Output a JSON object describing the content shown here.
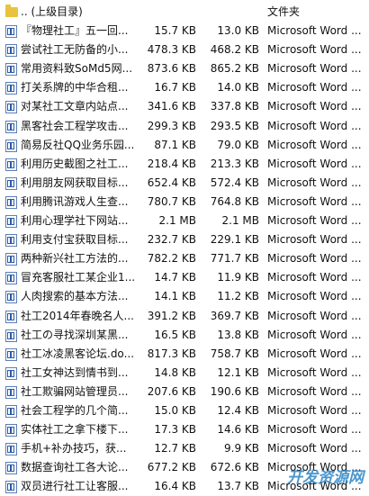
{
  "header": {
    "parent_label": ".. (上级目录)",
    "type_header": "文件夹"
  },
  "files": [
    {
      "name": "『物理社工』五一回...",
      "size": "15.7 KB",
      "packed": "13.0 KB",
      "type": "Microsoft Word ..."
    },
    {
      "name": "尝试社工无防备的小...",
      "size": "478.3 KB",
      "packed": "468.2 KB",
      "type": "Microsoft Word ..."
    },
    {
      "name": "常用资料致SoMd5网...",
      "size": "873.6 KB",
      "packed": "865.2 KB",
      "type": "Microsoft Word ..."
    },
    {
      "name": "打关系牌的中华合租...",
      "size": "16.7 KB",
      "packed": "14.0 KB",
      "type": "Microsoft Word ..."
    },
    {
      "name": "对某社工文章内站点...",
      "size": "341.6 KB",
      "packed": "337.8 KB",
      "type": "Microsoft Word ..."
    },
    {
      "name": "黑客社会工程学攻击...",
      "size": "299.3 KB",
      "packed": "293.5 KB",
      "type": "Microsoft Word ..."
    },
    {
      "name": "简易反社QQ业务乐园...",
      "size": "87.1 KB",
      "packed": "79.0 KB",
      "type": "Microsoft Word ..."
    },
    {
      "name": "利用历史截图之社工...",
      "size": "218.4 KB",
      "packed": "213.3 KB",
      "type": "Microsoft Word ..."
    },
    {
      "name": "利用朋友网获取目标...",
      "size": "652.4 KB",
      "packed": "572.4 KB",
      "type": "Microsoft Word ..."
    },
    {
      "name": "利用腾讯游戏人生查...",
      "size": "780.7 KB",
      "packed": "764.8 KB",
      "type": "Microsoft Word ..."
    },
    {
      "name": "利用心理学社下网站...",
      "size": "2.1 MB",
      "packed": "2.1 MB",
      "type": "Microsoft Word ..."
    },
    {
      "name": "利用支付宝获取目标...",
      "size": "232.7 KB",
      "packed": "229.1 KB",
      "type": "Microsoft Word ..."
    },
    {
      "name": "两种新兴社工方法的...",
      "size": "782.2 KB",
      "packed": "771.7 KB",
      "type": "Microsoft Word ..."
    },
    {
      "name": "冒充客服社工某企业1...",
      "size": "14.7 KB",
      "packed": "11.9 KB",
      "type": "Microsoft Word ..."
    },
    {
      "name": "人肉搜索的基本方法...",
      "size": "14.1 KB",
      "packed": "11.2 KB",
      "type": "Microsoft Word ..."
    },
    {
      "name": "社工2014年春晚名人...",
      "size": "391.2 KB",
      "packed": "369.7 KB",
      "type": "Microsoft Word ..."
    },
    {
      "name": "社工の寻找深圳某黑...",
      "size": "16.5 KB",
      "packed": "13.8 KB",
      "type": "Microsoft Word ..."
    },
    {
      "name": "社工冰凌黑客论坛.do...",
      "size": "817.3 KB",
      "packed": "758.7 KB",
      "type": "Microsoft Word ..."
    },
    {
      "name": "社工女神达到情书到...",
      "size": "14.8 KB",
      "packed": "12.1 KB",
      "type": "Microsoft Word ..."
    },
    {
      "name": "社工欺骗网站管理员...",
      "size": "207.6 KB",
      "packed": "190.6 KB",
      "type": "Microsoft Word ..."
    },
    {
      "name": "社会工程学的几个简...",
      "size": "15.0 KB",
      "packed": "12.4 KB",
      "type": "Microsoft Word ..."
    },
    {
      "name": "实体社工之拿下楼下...",
      "size": "17.3 KB",
      "packed": "14.6 KB",
      "type": "Microsoft Word ..."
    },
    {
      "name": "手机+补办技巧，获...",
      "size": "12.7 KB",
      "packed": "9.9 KB",
      "type": "Microsoft Word ..."
    },
    {
      "name": "数据查询社工各大论...",
      "size": "677.2 KB",
      "packed": "672.6 KB",
      "type": "Microsoft Word ..."
    },
    {
      "name": "双员进行社工让客服...",
      "size": "16.4 KB",
      "packed": "13.7 KB",
      "type": "Microsoft Word ..."
    }
  ],
  "watermark": "开发资源网"
}
